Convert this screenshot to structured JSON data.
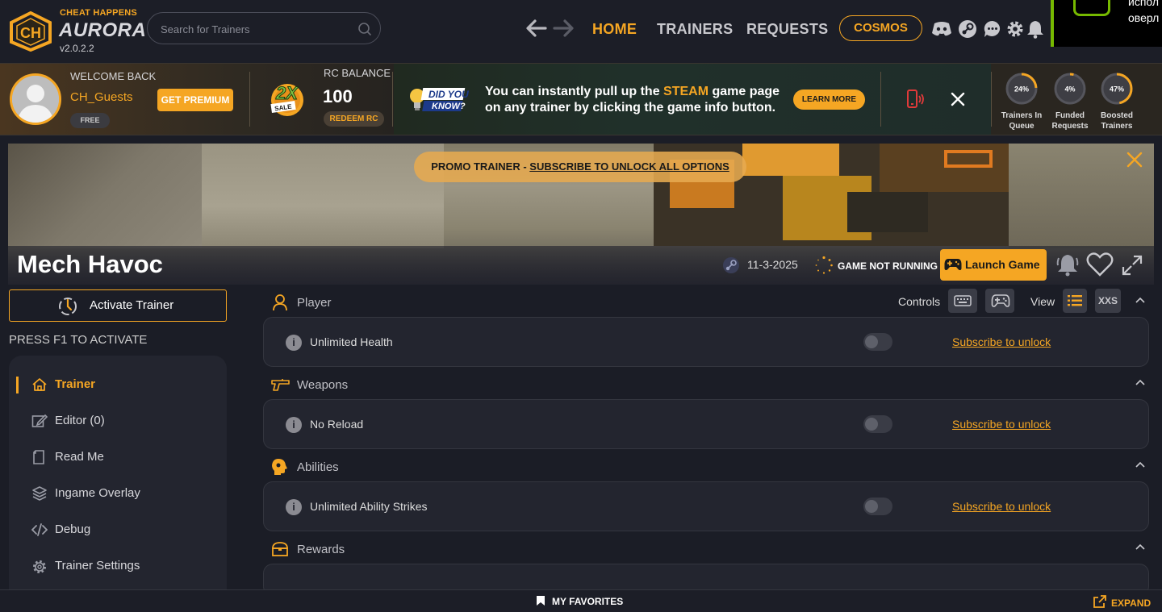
{
  "app": {
    "brand_top": "CHEAT HAPPENS",
    "brand_name": "AURORA",
    "version": "v2.0.2.2",
    "accent": "#f5a623"
  },
  "search": {
    "placeholder": "Search for Trainers"
  },
  "nav": {
    "home": "HOME",
    "trainers": "TRAINERS",
    "requests": "REQUESTS",
    "cosmos": "COSMOS",
    "icons": [
      "back-arrow-icon",
      "forward-arrow-icon",
      "discord-icon",
      "steam-icon",
      "chat-icon",
      "gear-icon",
      "bell-icon"
    ]
  },
  "overlay_popup": {
    "text_line1": "испол",
    "text_line2": "оверл"
  },
  "user": {
    "welcome": "WELCOME BACK",
    "name": "CH_Guests",
    "tier": "FREE",
    "get_premium": "GET PREMIUM"
  },
  "sale_badge": {
    "big": "2X",
    "small": "SALE"
  },
  "rc": {
    "label": "RC BALANCE",
    "value": "100",
    "redeem": "REDEEM RC"
  },
  "tip": {
    "badge_line1": "DID YOU",
    "badge_line2": "KNOW?",
    "text_before": "You can instantly pull up the ",
    "highlight": "STEAM",
    "text_after": " game page on any trainer by clicking the game info button.",
    "learn_more": "LEARN MORE"
  },
  "stats": [
    {
      "percent": "24%",
      "value": 24,
      "label": "Trainers In Queue"
    },
    {
      "percent": "4%",
      "value": 4,
      "label": "Funded Requests"
    },
    {
      "percent": "47%",
      "value": 47,
      "label": "Boosted Trainers"
    }
  ],
  "banner": {
    "promo_prefix": "PROMO TRAINER - ",
    "promo_link": "SUBSCRIBE TO UNLOCK ALL OPTIONS"
  },
  "game": {
    "title": "Mech Havoc",
    "date": "11-3-2025",
    "status": "GAME NOT RUNNING",
    "launch": "Launch Game"
  },
  "sidebar": {
    "activate": "Activate Trainer",
    "press_hint": "PRESS F1 TO ACTIVATE",
    "items": [
      {
        "label": "Trainer",
        "icon": "home-icon",
        "active": true
      },
      {
        "label": "Editor (0)",
        "icon": "edit-icon",
        "active": false
      },
      {
        "label": "Read Me",
        "icon": "document-icon",
        "active": false
      },
      {
        "label": "Ingame Overlay",
        "icon": "layers-icon",
        "active": false
      },
      {
        "label": "Debug",
        "icon": "code-icon",
        "active": false
      },
      {
        "label": "Trainer Settings",
        "icon": "gear-icon",
        "active": false
      }
    ]
  },
  "controls": {
    "controls_label": "Controls",
    "view_label": "View",
    "xxs": "XXS"
  },
  "categories": [
    {
      "name": "Player",
      "icon": "person-icon",
      "cheats": [
        {
          "name": "Unlimited Health",
          "action": "Subscribe to unlock",
          "enabled": false
        }
      ]
    },
    {
      "name": "Weapons",
      "icon": "gun-icon",
      "cheats": [
        {
          "name": "No Reload",
          "action": "Subscribe to unlock",
          "enabled": false
        }
      ]
    },
    {
      "name": "Abilities",
      "icon": "head-icon",
      "cheats": [
        {
          "name": "Unlimited Ability Strikes",
          "action": "Subscribe to unlock",
          "enabled": false
        }
      ]
    },
    {
      "name": "Rewards",
      "icon": "chest-icon",
      "cheats": []
    }
  ],
  "footer": {
    "favorites": "MY FAVORITES",
    "expand": "EXPAND"
  }
}
